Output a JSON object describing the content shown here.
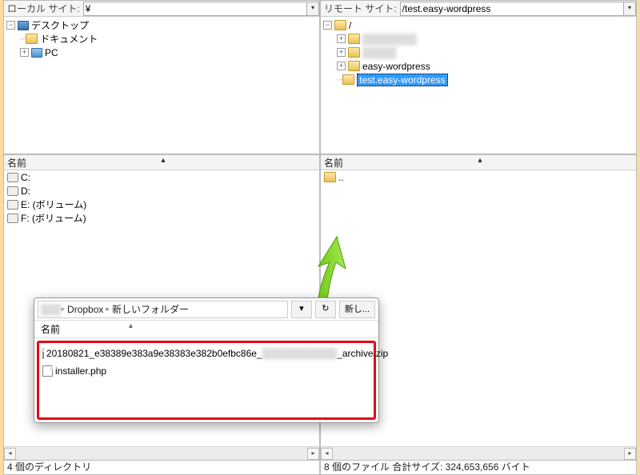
{
  "local": {
    "label": "ローカル サイト:",
    "path": "¥",
    "tree": {
      "root": "デスクトップ",
      "docs": "ドキュメント",
      "pc": "PC"
    },
    "name_header": "名前",
    "drives": {
      "c": "C:",
      "d": "D:",
      "e": "E: (ボリューム)",
      "f": "F: (ボリューム)"
    },
    "status": "4 個のディレクトリ"
  },
  "remote": {
    "label": "リモート サイト:",
    "path": "/test.easy-wordpress",
    "tree": {
      "root": "/",
      "folder3": "easy-wordpress",
      "folder4": "test.easy-wordpress"
    },
    "name_header": "名前",
    "up_dir": "..",
    "status": "8 個のファイル 合計サイズ: 324,653,656 バイト"
  },
  "overlay": {
    "bc1": "Dropbox",
    "bc2": "新しいフォルダー",
    "refresh_icon": "↻",
    "new_btn": "新し...",
    "name_header": "名前",
    "file1": "20180821_e38389e383a9e38383e382b0efbc86e_",
    "file1_suffix": "_archive.zip",
    "file2": "installer.php"
  }
}
